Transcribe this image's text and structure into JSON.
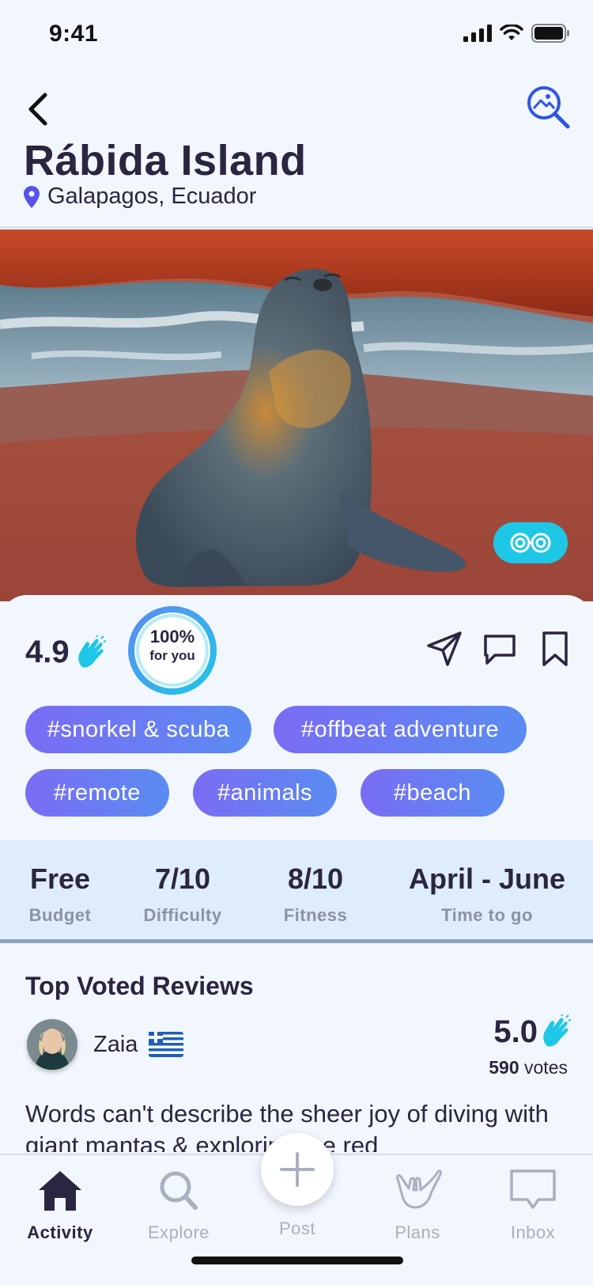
{
  "status_bar": {
    "time": "9:41"
  },
  "header": {
    "title": "Rábida Island",
    "location": "Galapagos, Ecuador"
  },
  "summary": {
    "rating": "4.9",
    "match_percent": "100%",
    "match_label": "for you"
  },
  "tags": [
    "#snorkel & scuba",
    "#offbeat adventure",
    "#remote",
    "#animals",
    "#beach"
  ],
  "stats": [
    {
      "value": "Free",
      "label": "Budget"
    },
    {
      "value": "7/10",
      "label": "Difficulty"
    },
    {
      "value": "8/10",
      "label": "Fitness"
    },
    {
      "value": "April - June",
      "label": "Time to go"
    }
  ],
  "reviews": {
    "title": "Top Voted Reviews",
    "top": {
      "name": "Zaia",
      "score": "5.0",
      "votes": "590",
      "votes_label": "votes",
      "text": "Words can't describe the sheer joy of diving with giant mantas & exploring the red"
    }
  },
  "tabbar": {
    "items": [
      {
        "label": "Activity",
        "icon": "home-icon",
        "active": true
      },
      {
        "label": "Explore",
        "icon": "search-icon",
        "active": false
      },
      {
        "label": "Post",
        "icon": "plus-icon",
        "active": false
      },
      {
        "label": "Plans",
        "icon": "hang-loose-icon",
        "active": false
      },
      {
        "label": "Inbox",
        "icon": "chat-icon",
        "active": false
      }
    ]
  },
  "colors": {
    "accent": "#5a8cf2",
    "tag_gradient_start": "#7a6cf4",
    "vr_button": "#1ec7e6",
    "text_dark": "#2a2540",
    "muted": "#a8b0c0"
  }
}
